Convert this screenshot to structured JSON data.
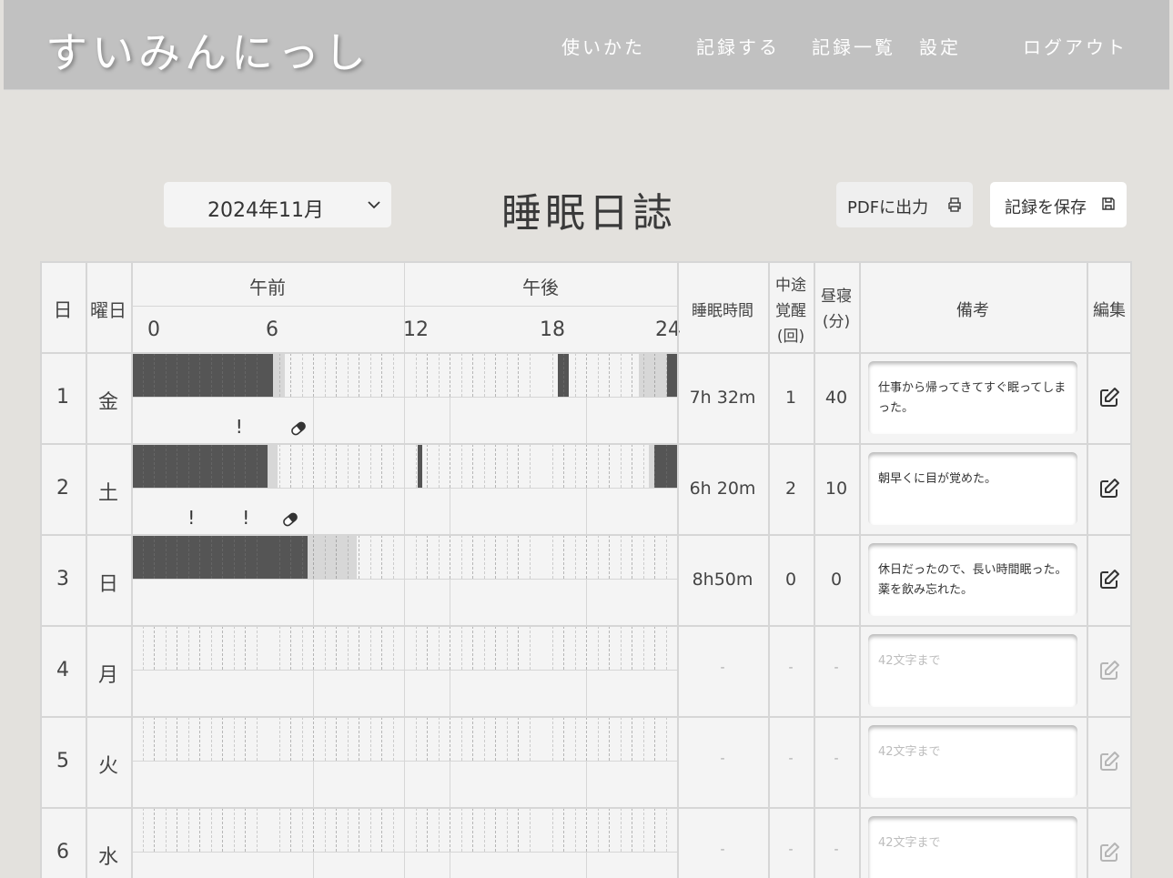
{
  "app": {
    "title": "すいみんにっし",
    "nav": [
      "使いかた",
      "記録する",
      "記録一覧",
      "設定"
    ],
    "logout": "ログアウト"
  },
  "toolbar": {
    "month": "2024年11月",
    "page_title": "睡眠日誌",
    "pdf_label": "PDFに出力",
    "save_label": "記録を保存"
  },
  "table": {
    "headers": {
      "day": "日",
      "weekday": "曜日",
      "am": "午前",
      "pm": "午後",
      "hours": [
        "0",
        "6",
        "12",
        "18",
        "24"
      ],
      "sleep_time": "睡眠時間",
      "wake_lines": [
        "中途",
        "覚醒",
        "(回)"
      ],
      "nap_lines": [
        "昼寝",
        "(分)"
      ],
      "notes": "備考",
      "edit": "編集"
    },
    "note_placeholder": "42文字まで",
    "rows": [
      {
        "day": "1",
        "weekday": "金",
        "sleep_time": "7h 32m",
        "wakeups": "1",
        "nap": "40",
        "note": "仕事から帰ってきてすぐ眠ってしまった。",
        "sleep": [
          [
            0,
            6.25
          ],
          [
            18.75,
            19.25
          ],
          [
            23.55,
            24
          ]
        ],
        "bed": [
          [
            6.25,
            6.75
          ],
          [
            22.3,
            23.55
          ]
        ],
        "arrows": [
          [
            6.75,
            9
          ],
          [
            12.5,
            13.5
          ],
          [
            17.4,
            18.8
          ]
        ],
        "marks": [
          {
            "h": 4.75,
            "type": "caffeine-mark"
          },
          {
            "h": 7.35,
            "type": "pill-icon"
          }
        ]
      },
      {
        "day": "2",
        "weekday": "土",
        "sleep_time": "6h 20m",
        "wakeups": "2",
        "nap": "10",
        "note": "朝早くに目が覚めた。",
        "sleep": [
          [
            0,
            6
          ],
          [
            12.6,
            12.8
          ],
          [
            23,
            24
          ]
        ],
        "bed": [
          [
            6,
            6.45
          ],
          [
            22.75,
            23
          ]
        ],
        "arrows": [
          [
            6.4,
            8
          ],
          [
            13.5,
            15.6
          ]
        ],
        "marks": [
          {
            "h": 2.65,
            "type": "caffeine-mark"
          },
          {
            "h": 5.05,
            "type": "caffeine-mark"
          },
          {
            "h": 7,
            "type": "pill-icon"
          }
        ]
      },
      {
        "day": "3",
        "weekday": "日",
        "sleep_time": "8h50m",
        "wakeups": "0",
        "nap": "0",
        "note": "休日だったので、長い時間眠った。薬を飲み忘れた。",
        "sleep": [
          [
            0,
            7.75
          ]
        ],
        "bed": [
          [
            7.75,
            9.9
          ]
        ],
        "arrows": [],
        "marks": []
      },
      {
        "day": "4",
        "weekday": "月",
        "sleep_time": "-",
        "wakeups": "-",
        "nap": "-",
        "note": "",
        "sleep": [],
        "bed": [],
        "arrows": [],
        "marks": []
      },
      {
        "day": "5",
        "weekday": "火",
        "sleep_time": "-",
        "wakeups": "-",
        "nap": "-",
        "note": "",
        "sleep": [],
        "bed": [],
        "arrows": [],
        "marks": []
      },
      {
        "day": "6",
        "weekday": "水",
        "sleep_time": "-",
        "wakeups": "-",
        "nap": "-",
        "note": "",
        "sleep": [],
        "bed": [],
        "arrows": [],
        "marks": []
      }
    ]
  },
  "colors": {
    "sleep": "#555555",
    "in_bed": "#d7d7d7",
    "grid_line": "#d6d6d6",
    "cell_bg": "#f4f4f4",
    "page_bg": "#e3e1dd",
    "header_bg": "#c1c1c1"
  }
}
